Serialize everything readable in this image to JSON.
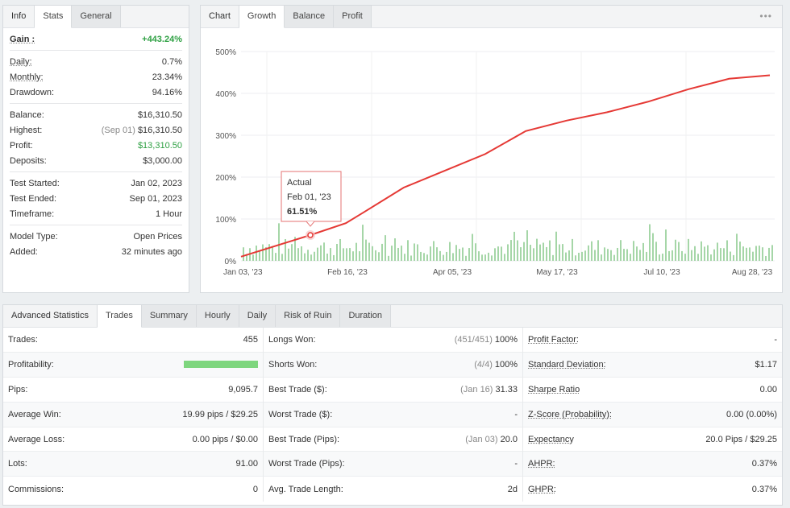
{
  "info": {
    "tabs": [
      "Info",
      "Stats",
      "General"
    ],
    "active_tab": "Stats",
    "gain": {
      "label": "Gain :",
      "value": "+443.24%"
    },
    "daily": {
      "label": "Daily:",
      "value": "0.7%"
    },
    "monthly": {
      "label": "Monthly:",
      "value": "23.34%"
    },
    "drawdown": {
      "label": "Drawdown:",
      "value": "94.16%"
    },
    "balance": {
      "label": "Balance:",
      "value": "$16,310.50"
    },
    "highest": {
      "label": "Highest:",
      "date": "(Sep 01)",
      "value": "$16,310.50"
    },
    "profit": {
      "label": "Profit:",
      "value": "$13,310.50"
    },
    "deposits": {
      "label": "Deposits:",
      "value": "$3,000.00"
    },
    "test_started": {
      "label": "Test Started:",
      "value": "Jan 02, 2023"
    },
    "test_ended": {
      "label": "Test Ended:",
      "value": "Sep 01, 2023"
    },
    "timeframe": {
      "label": "Timeframe:",
      "value": "1 Hour"
    },
    "model_type": {
      "label": "Model Type:",
      "value": "Open Prices"
    },
    "added": {
      "label": "Added:",
      "value": "32 minutes ago"
    }
  },
  "chart_tabs": [
    "Chart",
    "Growth",
    "Balance",
    "Profit"
  ],
  "chart_active_tab": "Growth",
  "menu_icon": "more-dots-icon",
  "chart_data": {
    "type": "line",
    "y_ticks": [
      "500%",
      "400%",
      "300%",
      "200%",
      "100%",
      "0%"
    ],
    "x_ticks": [
      "Jan 03, '23",
      "Feb 16, '23",
      "Apr 05, '23",
      "May 17, '23",
      "Jul 10, '23",
      "Aug 28, '23"
    ],
    "ylim": [
      0,
      500
    ],
    "series": [
      {
        "color": "#e53935",
        "x": [
          "Jan 03",
          "Feb 01",
          "Feb 16",
          "Mar 05",
          "Apr 05",
          "Apr 20",
          "May 17",
          "Jun 05",
          "Jun 20",
          "Jul 10",
          "Jul 25",
          "Aug 10",
          "Aug 28",
          "Sep 01"
        ],
        "values": [
          10,
          61.51,
          90,
          115,
          175,
          215,
          255,
          310,
          335,
          355,
          380,
          410,
          435,
          443.24
        ]
      }
    ],
    "bars_color": "#a5d6a7",
    "tooltip": {
      "title": "Actual",
      "date": "Feb 01, '23",
      "value": "61.51%"
    }
  },
  "adv": {
    "title": "Advanced Statistics",
    "tabs": [
      "Trades",
      "Summary",
      "Hourly",
      "Daily",
      "Risk of Ruin",
      "Duration"
    ],
    "active_tab": "Trades",
    "col1": [
      {
        "label": "Trades:",
        "value": "455"
      },
      {
        "label": "Profitability:",
        "value": "",
        "progress": 1.0
      },
      {
        "label": "Pips:",
        "value": "9,095.7"
      },
      {
        "label": "Average Win:",
        "value": "19.99 pips / $29.25"
      },
      {
        "label": "Average Loss:",
        "value": "0.00 pips / $0.00"
      },
      {
        "label": "Lots:",
        "value": "91.00"
      },
      {
        "label": "Commissions:",
        "value": "0"
      }
    ],
    "col2": [
      {
        "label": "Longs Won:",
        "pre": "(451/451)",
        "value": "100%"
      },
      {
        "label": "Shorts Won:",
        "pre": "(4/4)",
        "value": "100%"
      },
      {
        "label": "Best Trade ($):",
        "pre": "(Jan 16)",
        "value": "31.33"
      },
      {
        "label": "Worst Trade ($):",
        "pre": "",
        "value": "-"
      },
      {
        "label": "Best Trade (Pips):",
        "pre": "(Jan 03)",
        "value": "20.0"
      },
      {
        "label": "Worst Trade (Pips):",
        "pre": "",
        "value": "-"
      },
      {
        "label": "Avg. Trade Length:",
        "pre": "",
        "value": "2d"
      }
    ],
    "col3": [
      {
        "label": "Profit Factor:",
        "value": "-"
      },
      {
        "label": "Standard Deviation:",
        "value": "$1.17"
      },
      {
        "label": "Sharpe Ratio",
        "value": "0.00"
      },
      {
        "label": "Z-Score (Probability):",
        "value": "0.00 (0.00%)"
      },
      {
        "label": "Expectancy",
        "value": "20.0 Pips / $29.25"
      },
      {
        "label": "AHPR:",
        "value": "0.37%"
      },
      {
        "label": "GHPR:",
        "value": "0.37%"
      }
    ]
  }
}
